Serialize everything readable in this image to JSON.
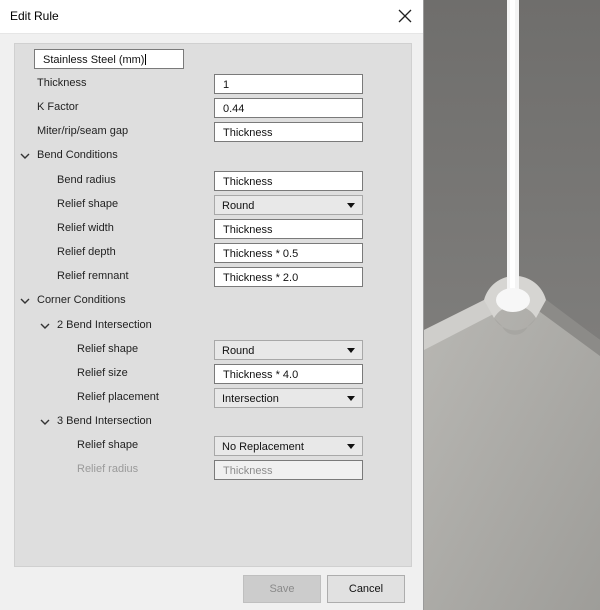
{
  "dialog": {
    "title": "Edit Rule",
    "rule_name": "Stainless Steel (mm)"
  },
  "fields": {
    "thickness": {
      "label": "Thickness",
      "value": "1"
    },
    "k_factor": {
      "label": "K Factor",
      "value": "0.44"
    },
    "gap": {
      "label": "Miter/rip/seam gap",
      "value": "Thickness"
    }
  },
  "bend_conditions": {
    "header": "Bend Conditions",
    "bend_radius": {
      "label": "Bend radius",
      "value": "Thickness"
    },
    "relief_shape": {
      "label": "Relief shape",
      "value": "Round"
    },
    "relief_width": {
      "label": "Relief width",
      "value": "Thickness"
    },
    "relief_depth": {
      "label": "Relief depth",
      "value": "Thickness * 0.5"
    },
    "relief_remnant": {
      "label": "Relief remnant",
      "value": "Thickness * 2.0"
    }
  },
  "corner_conditions": {
    "header": "Corner Conditions",
    "two_bend": {
      "header": "2 Bend Intersection",
      "relief_shape": {
        "label": "Relief shape",
        "value": "Round"
      },
      "relief_size": {
        "label": "Relief size",
        "value": "Thickness * 4.0"
      },
      "relief_placement": {
        "label": "Relief placement",
        "value": "Intersection"
      }
    },
    "three_bend": {
      "header": "3 Bend Intersection",
      "relief_shape": {
        "label": "Relief shape",
        "value": "No Replacement"
      },
      "relief_radius": {
        "label": "Relief radius",
        "value": "Thickness"
      }
    }
  },
  "buttons": {
    "save": "Save",
    "cancel": "Cancel"
  },
  "icons": {
    "close": "close-icon",
    "expand": "chevron-down-icon"
  }
}
